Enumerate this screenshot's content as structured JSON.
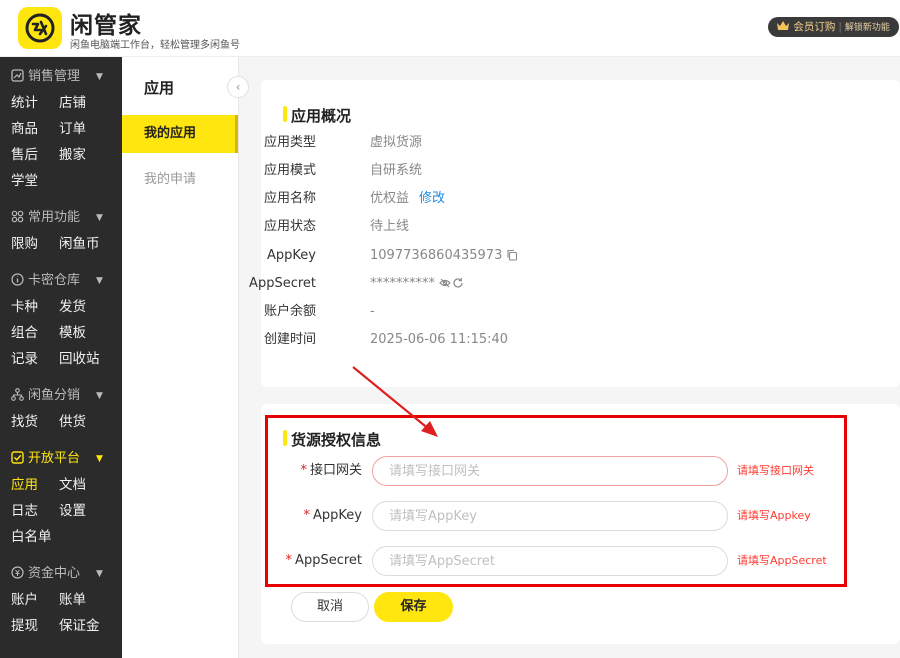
{
  "header": {
    "app_name": "闲管家",
    "subtitle": "闲鱼电脑端工作台，轻松管理多闲鱼号",
    "vip_label": "会员订购",
    "vip_sub": "解锁新功能"
  },
  "sidebar": {
    "groups": [
      {
        "title": "销售管理",
        "icon": "chart-icon",
        "items": [
          [
            "统计",
            "店铺"
          ],
          [
            "商品",
            "订单"
          ],
          [
            "售后",
            "搬家"
          ],
          [
            "学堂"
          ]
        ]
      },
      {
        "title": "常用功能",
        "icon": "grid-icon",
        "items": [
          [
            "限购",
            "闲鱼币"
          ]
        ]
      },
      {
        "title": "卡密仓库",
        "icon": "info-icon",
        "items": [
          [
            "卡种",
            "发货"
          ],
          [
            "组合",
            "模板"
          ],
          [
            "记录",
            "回收站"
          ]
        ]
      },
      {
        "title": "闲鱼分销",
        "icon": "tree-icon",
        "items": [
          [
            "找货",
            "供货"
          ]
        ]
      },
      {
        "title": "开放平台",
        "icon": "check-square-icon",
        "active": true,
        "items": [
          [
            "应用",
            "文档"
          ],
          [
            "日志",
            "设置"
          ],
          [
            "白名单"
          ]
        ]
      },
      {
        "title": "资金中心",
        "icon": "coin-icon",
        "items": [
          [
            "账户",
            "账单"
          ],
          [
            "提现",
            "保证金"
          ]
        ]
      }
    ],
    "active_item": "应用",
    "accent": "#ffe60f"
  },
  "subnav": {
    "title": "应用",
    "items": [
      {
        "label": "我的应用",
        "active": true
      },
      {
        "label": "我的申请",
        "active": false
      }
    ]
  },
  "overview": {
    "title": "应用概况",
    "rows": [
      {
        "label": "应用类型",
        "value": "虚拟货源"
      },
      {
        "label": "应用模式",
        "value": "自研系统"
      },
      {
        "label": "应用名称",
        "value": "优权益",
        "link": "修改"
      },
      {
        "label": "应用状态",
        "value": "待上线"
      },
      {
        "label": "AppKey",
        "value": "1097736860435973",
        "icon": "copy-icon"
      },
      {
        "label": "AppSecret",
        "value": "**********",
        "icon": "eye-off-icon",
        "icon2": "refresh-icon"
      },
      {
        "label": "账户余额",
        "value": "-"
      },
      {
        "label": "创建时间",
        "value": "2025-06-06 11:15:40"
      }
    ]
  },
  "auth": {
    "title": "货源授权信息",
    "fields": [
      {
        "label": "接口网关",
        "placeholder": "请填写接口网关",
        "value": "",
        "error": "请填写接口网关"
      },
      {
        "label": "AppKey",
        "placeholder": "请填写AppKey",
        "value": "",
        "error": "请填写Appkey"
      },
      {
        "label": "AppSecret",
        "placeholder": "请填写AppSecret",
        "value": "",
        "error": "请填写AppSecret"
      }
    ],
    "cancel_label": "取消",
    "save_label": "保存"
  }
}
